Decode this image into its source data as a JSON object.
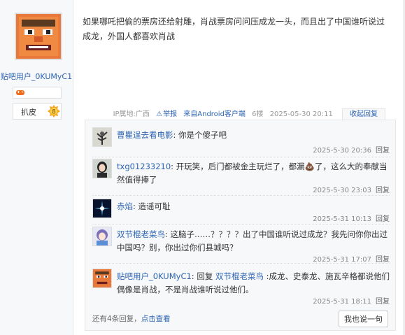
{
  "author": {
    "username": "贴吧用户_0KUMyC1",
    "level_label": "扒皮",
    "level_number": "8",
    "avatar_icon": "pixel-face-avatar",
    "badge_icon": "gamepad-icon"
  },
  "post": {
    "content": "如果哪吒把偷的票房还给射雕，肖战票房问问压成龙一头，而且出了中国谁听说过成龙，外国人都喜欢肖战",
    "ip": "IP属地:广西",
    "report": "举报",
    "source": "来自Android客户端",
    "floor": "6楼",
    "date": "2025-05-30 20:11",
    "collapse": "收起回复"
  },
  "replies": [
    {
      "name": "曹瞿逞去看电影",
      "sep": ": ",
      "text": "你是个傻子吧",
      "time": "2025-5-30 20:36",
      "reply_label": "回复",
      "avatar_icon": "plant-avatar"
    },
    {
      "name": "txg01233210",
      "sep": ": ",
      "text": "开玩笑，后门都被金主玩烂了，都漏💩了，这么大的奉献当然值得捧了",
      "time": "2025-5-30 23:03",
      "reply_label": "回复",
      "avatar_icon": "girl-avatar"
    },
    {
      "name": "赤焰",
      "sep": ": ",
      "text": "造谣可耻",
      "time": "2025-5-31 10:13",
      "reply_label": "回复",
      "avatar_icon": "starburst-avatar"
    },
    {
      "name": "双节棍老菜鸟",
      "sep": ": ",
      "text": "这脑子……？？？？出了中国谁听说过成龙？我先问你你出过中国吗？别，你出过你们县城吗？",
      "time": "2025-5-31 17:07",
      "reply_label": "回复",
      "avatar_icon": "anime-avatar"
    },
    {
      "name": "贴吧用户_0KUMyC1",
      "sep": ": 回复 ",
      "target": "双节棍老菜鸟",
      "text": " :成龙、史泰龙、施瓦辛格都说他们偶像是肖战，不是肖战谁听说过他们。",
      "time": "2025-5-31 18:11",
      "reply_label": "回复",
      "avatar_icon": "pixel-face-avatar"
    }
  ],
  "more": {
    "prefix": "还有4条回复，",
    "link": "点击查看"
  },
  "say_button": "我也说一句",
  "colors": {
    "link": "#2d64b3",
    "reply_bg": "#f7f8fa"
  }
}
